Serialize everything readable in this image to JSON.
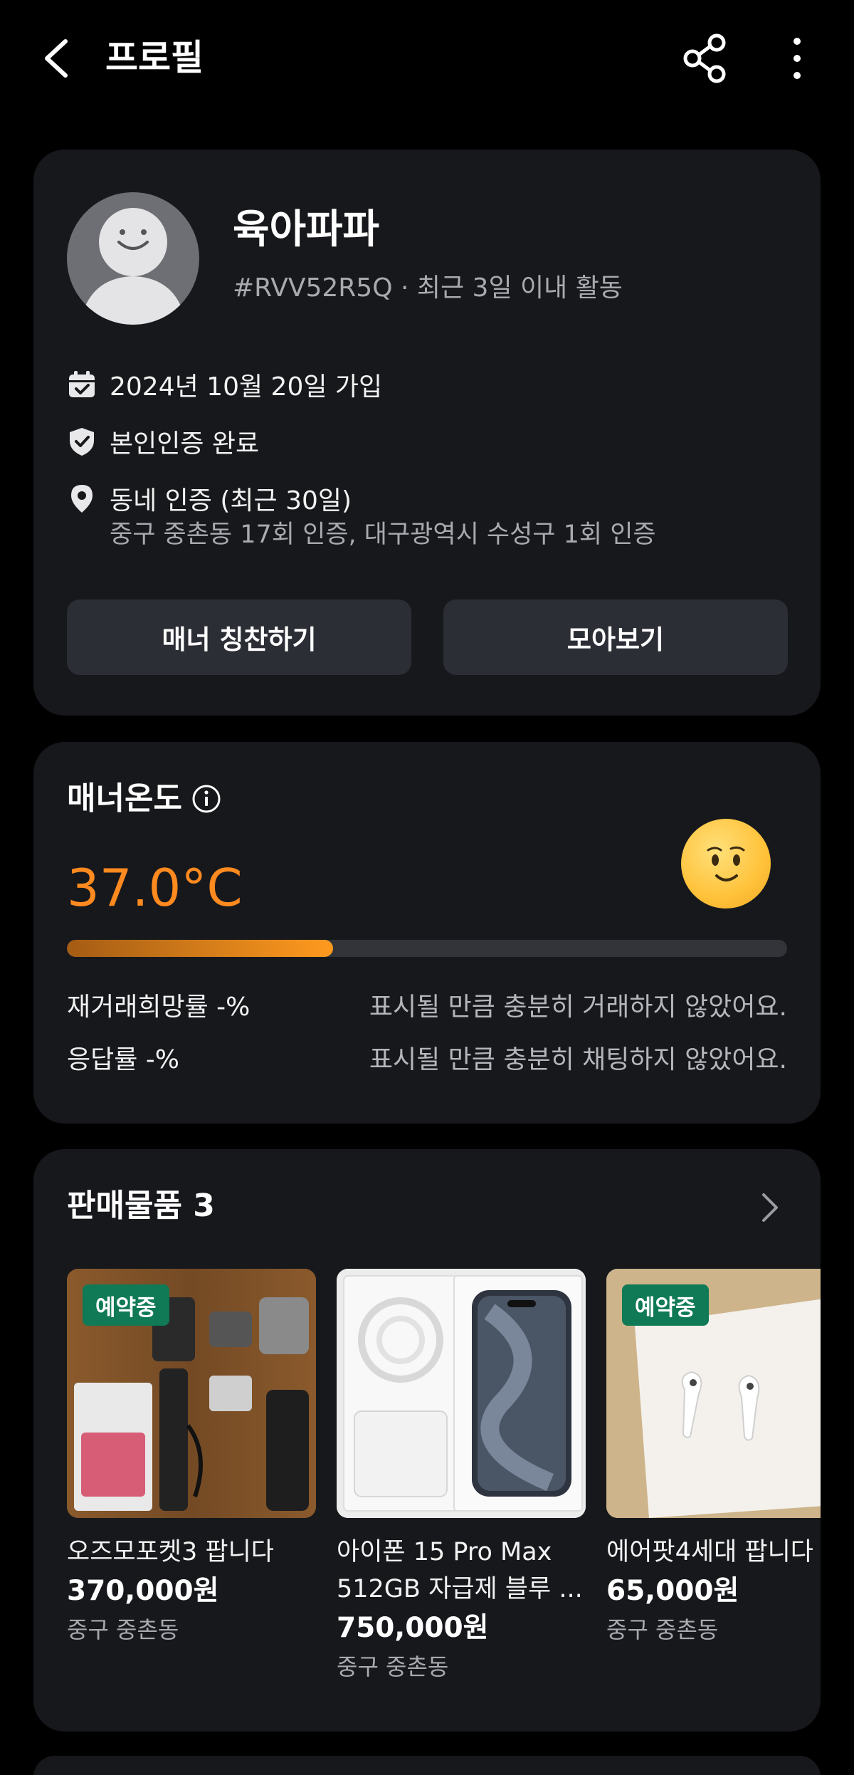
{
  "header": {
    "title": "프로필"
  },
  "profile": {
    "nickname": "육아파파",
    "sub_info": "#RVV52R5Q · 최근 3일 이내 활동",
    "joined": "2024년 10월 20일 가입",
    "verified": "본인인증 완료",
    "neighborhood": "동네 인증 (최근 30일)",
    "neighborhood_detail": "중구 중촌동 17회 인증, 대구광역시 수성구 1회 인증",
    "praise_button": "매너 칭찬하기",
    "collection_button": "모아보기"
  },
  "manner": {
    "title": "매너온도",
    "temperature": "37.0°C",
    "temperature_fill_fraction": 0.37,
    "colors": {
      "accent": "#ff8a1f",
      "bar_start": "#a45c14"
    },
    "rehire_label": "재거래희망률 -%",
    "rehire_desc": "표시될 만큼 충분히 거래하지 않았어요.",
    "response_label": "응답률 -%",
    "response_desc": "표시될 만큼 충분히 채팅하지 않았어요."
  },
  "sales": {
    "title": "판매물품 3",
    "items": [
      {
        "badge": "예약중",
        "title": "오즈모포켓3 팝니다",
        "price": "370,000원",
        "location": "중구 중촌동"
      },
      {
        "badge": "",
        "title_line1": "아이폰 15 Pro Max",
        "title_line2": "512GB 자급제 블루 ...",
        "price": "750,000원",
        "location": "중구 중촌동"
      },
      {
        "badge": "예약중",
        "title": "에어팟4세대 팝니다",
        "price": "65,000원",
        "location": "중구 중촌동"
      }
    ]
  }
}
